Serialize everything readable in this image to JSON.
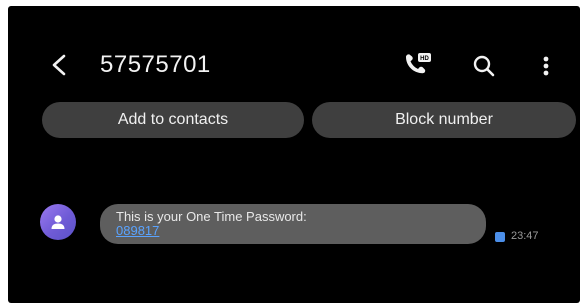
{
  "header": {
    "title": "57575701",
    "icons": [
      "back-arrow-icon",
      "hd-phone-icon",
      "search-icon",
      "more-vert-icon"
    ]
  },
  "actions": {
    "add_to_contacts": "Add to contacts",
    "block_number": "Block number"
  },
  "message": {
    "text": "This is your One Time Password:",
    "otp": "089817",
    "time": "23:47"
  },
  "colors": {
    "background": "#000000",
    "pill": "#3f3f3f",
    "bubble": "#5e5e5e",
    "link": "#5aa3ff",
    "avatar": "#7b66e0"
  }
}
